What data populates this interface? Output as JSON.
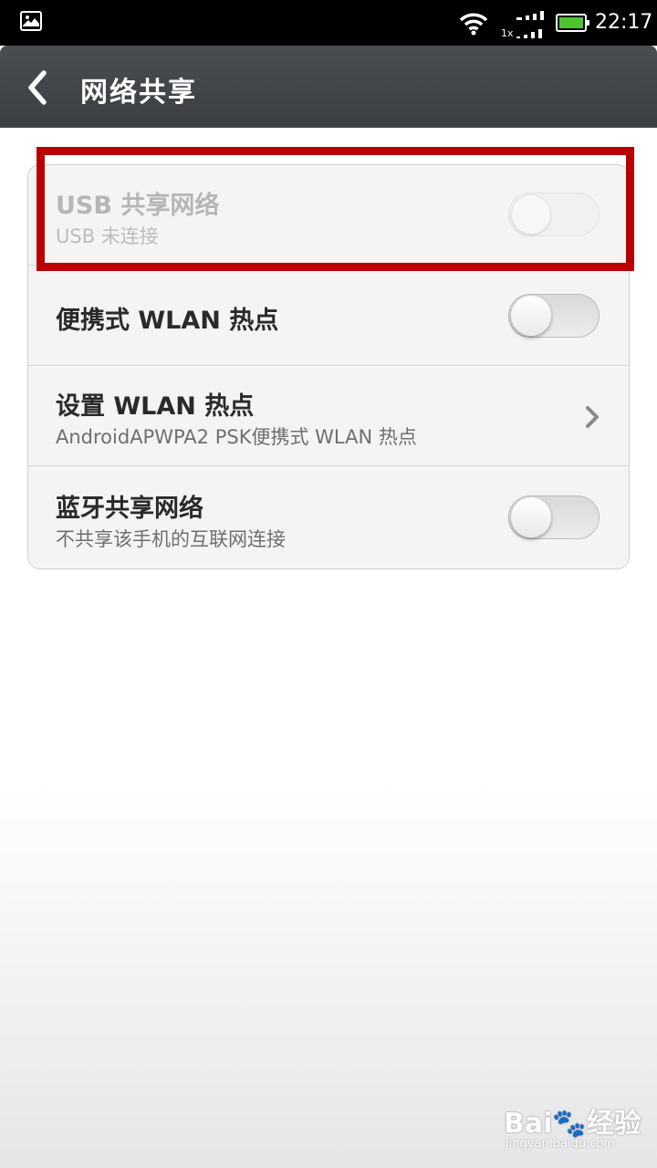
{
  "status_bar": {
    "network_type": "1x",
    "time": "22:17",
    "icons": [
      "gallery-icon",
      "wifi-icon",
      "signal-icon",
      "battery-icon"
    ],
    "battery_color": "#4ec52e"
  },
  "header": {
    "title": "网络共享",
    "background": "#404348"
  },
  "settings": {
    "items": [
      {
        "title": "USB 共享网络",
        "subtitle": "USB 未连接",
        "control": "toggle",
        "state": "off",
        "enabled": false
      },
      {
        "title": "便携式 WLAN 热点",
        "subtitle": "",
        "control": "toggle",
        "state": "off",
        "enabled": true
      },
      {
        "title": "设置 WLAN 热点",
        "subtitle": "AndroidAPWPA2 PSK便携式 WLAN 热点",
        "control": "chevron",
        "enabled": true
      },
      {
        "title": "蓝牙共享网络",
        "subtitle": "不共享该手机的互联网连接",
        "control": "toggle",
        "state": "off",
        "enabled": true
      }
    ]
  },
  "annotation": {
    "color": "#b80000"
  },
  "watermark": {
    "logo": "Bai🐾经验",
    "url": "jingyan.baidu.com"
  }
}
